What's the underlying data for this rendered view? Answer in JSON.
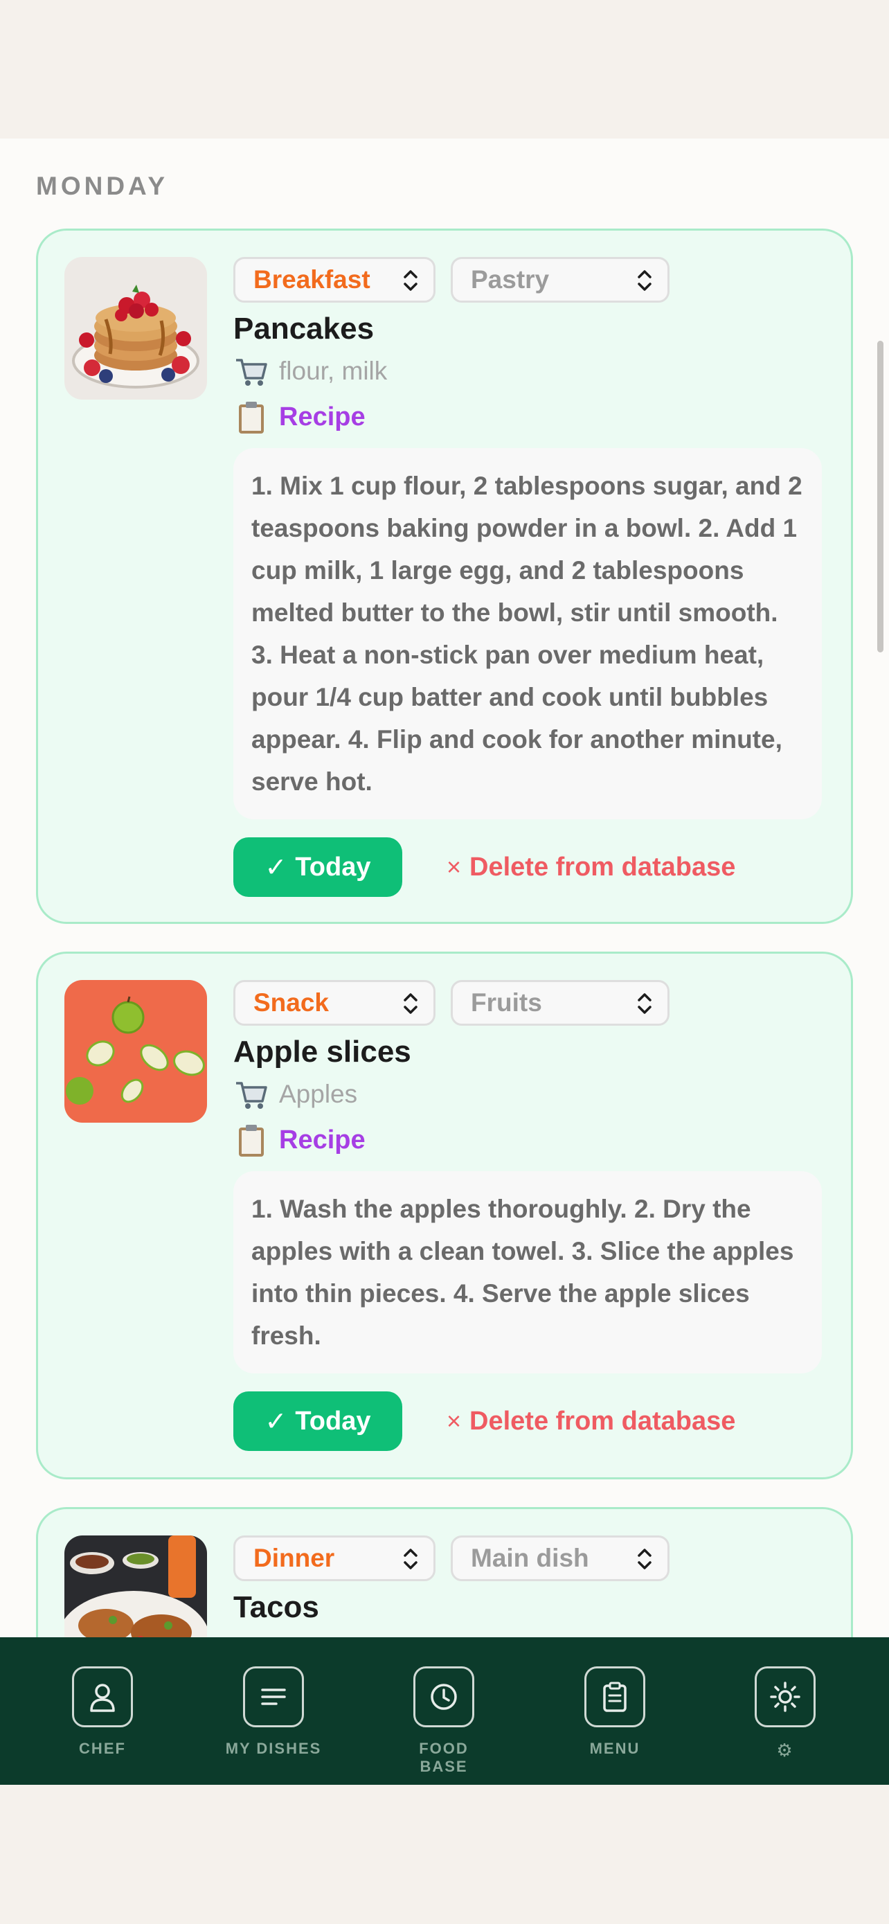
{
  "day": {
    "label": "MONDAY"
  },
  "cards": [
    {
      "photo_icon": "pancakes-photo",
      "meal": "Breakfast",
      "category": "Pastry",
      "name": "Pancakes",
      "ingredients": "flour, milk",
      "recipe_label": "Recipe",
      "recipe_text": "1. Mix 1 cup flour, 2 tablespoons sugar, and 2 teaspoons baking powder in a bowl. 2. Add 1 cup milk, 1 large egg, and 2 tablespoons melted butter to the bowl, stir until smooth. 3. Heat a non-stick pan over medium heat, pour 1/4 cup batter and cook until bubbles appear. 4. Flip and cook for another minute, serve hot.",
      "today_label": "Today",
      "delete_label": "Delete from database"
    },
    {
      "photo_icon": "apple-slices-photo",
      "meal": "Snack",
      "category": "Fruits",
      "name": "Apple slices",
      "ingredients": "Apples",
      "recipe_label": "Recipe",
      "recipe_text": "1. Wash the apples thoroughly. 2. Dry the apples with a clean towel. 3. Slice the apples into thin pieces. 4. Serve the apple slices fresh.",
      "today_label": "Today",
      "delete_label": "Delete from database"
    },
    {
      "photo_icon": "tacos-photo",
      "meal": "Dinner",
      "category": "Main dish",
      "name": "Tacos"
    }
  ],
  "nav": [
    {
      "label": "CHEF",
      "icon": "person-icon"
    },
    {
      "label": "MY DISHES",
      "icon": "list-icon"
    },
    {
      "label": "FOOD BASE",
      "icon": "clock-icon"
    },
    {
      "label": "MENU",
      "icon": "clipboard-icon"
    },
    {
      "label": "⚙",
      "icon": "sun-icon"
    }
  ],
  "colors": {
    "accent_green": "#0fbf77",
    "meal_orange": "#f26b1d",
    "recipe_purple": "#a63ee4",
    "delete_red": "#ef5b62",
    "nav_bg": "#0c3b2b",
    "card_bg": "#ecfbf3"
  }
}
